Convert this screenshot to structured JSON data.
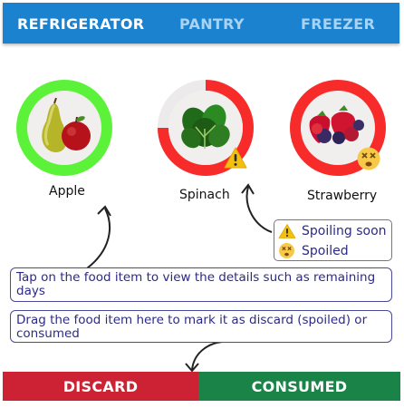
{
  "tabs": [
    {
      "label": "REFRIGERATOR",
      "active": true
    },
    {
      "label": "PANTRY",
      "active": false
    },
    {
      "label": "FREEZER",
      "active": false
    }
  ],
  "foods": [
    {
      "name": "Apple",
      "status": "fresh",
      "ring_color": "#5cf23a"
    },
    {
      "name": "Spinach",
      "status": "spoiling soon",
      "ring_color": "#f82b2b"
    },
    {
      "name": "Strawberry",
      "status": "spoiled",
      "ring_color": "#f82b2b"
    }
  ],
  "legend": [
    {
      "icon": "warning-icon",
      "label": "Spoiling soon"
    },
    {
      "icon": "dizzy-face-icon",
      "label": "Spoiled"
    }
  ],
  "hints": {
    "tap": "Tap on the food item to view the details such as remaining days",
    "drag": "Drag the food item here to mark it as discard (spoiled) or consumed"
  },
  "actions": {
    "discard": "DISCARD",
    "consumed": "CONSUMED"
  },
  "colors": {
    "tabbar": "#1a82cf",
    "discard": "#cc2233",
    "consumed": "#1a8348"
  }
}
